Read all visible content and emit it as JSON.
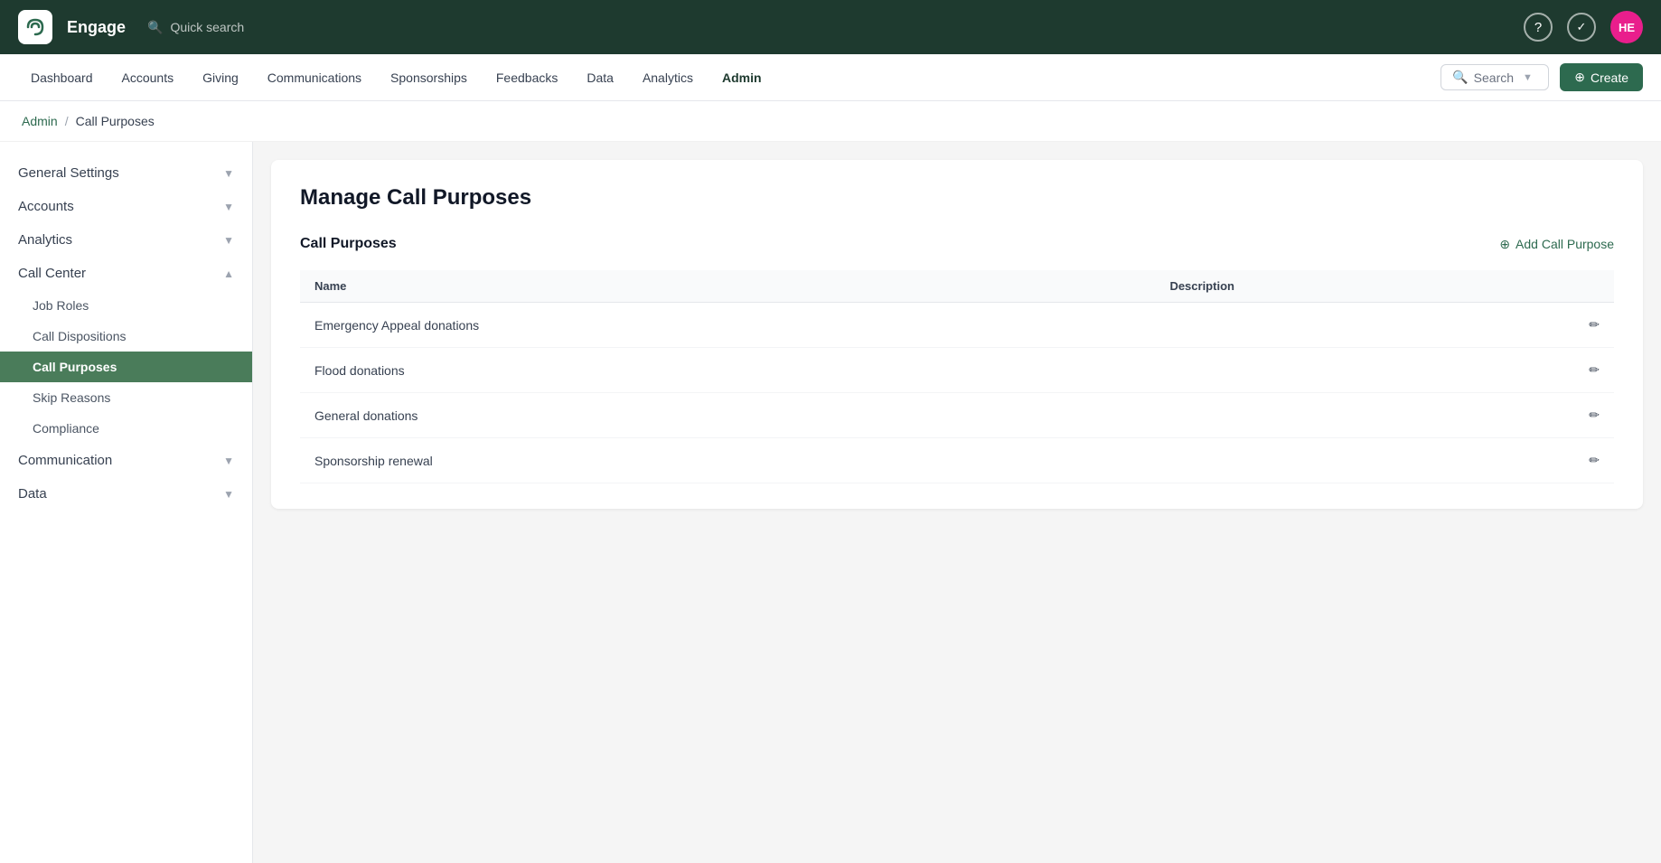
{
  "topbar": {
    "app_name": "Engage",
    "search_placeholder": "Quick search",
    "user_initials": "HE"
  },
  "secondnav": {
    "items": [
      {
        "label": "Dashboard",
        "active": false
      },
      {
        "label": "Accounts",
        "active": false
      },
      {
        "label": "Giving",
        "active": false
      },
      {
        "label": "Communications",
        "active": false
      },
      {
        "label": "Sponsorships",
        "active": false
      },
      {
        "label": "Feedbacks",
        "active": false
      },
      {
        "label": "Data",
        "active": false
      },
      {
        "label": "Analytics",
        "active": false
      },
      {
        "label": "Admin",
        "active": true
      }
    ],
    "search_label": "Search",
    "create_label": "Create"
  },
  "breadcrumb": {
    "parent": "Admin",
    "current": "Call Purposes"
  },
  "sidebar": {
    "sections": [
      {
        "label": "General Settings",
        "expanded": false,
        "items": []
      },
      {
        "label": "Accounts",
        "expanded": false,
        "items": []
      },
      {
        "label": "Analytics",
        "expanded": false,
        "items": []
      },
      {
        "label": "Call Center",
        "expanded": true,
        "items": [
          {
            "label": "Job Roles",
            "active": false
          },
          {
            "label": "Call Dispositions",
            "active": false
          },
          {
            "label": "Call Purposes",
            "active": true
          },
          {
            "label": "Skip Reasons",
            "active": false
          },
          {
            "label": "Compliance",
            "active": false
          }
        ]
      },
      {
        "label": "Communication",
        "expanded": false,
        "items": []
      },
      {
        "label": "Data",
        "expanded": false,
        "items": []
      }
    ]
  },
  "main": {
    "page_title": "Manage Call Purposes",
    "section_label": "Call Purposes",
    "add_button_label": "Add Call Purpose",
    "table_headers": [
      "Name",
      "Description"
    ],
    "rows": [
      {
        "name": "Emergency Appeal donations",
        "description": ""
      },
      {
        "name": "Flood donations",
        "description": ""
      },
      {
        "name": "General donations",
        "description": ""
      },
      {
        "name": "Sponsorship renewal",
        "description": ""
      }
    ]
  },
  "colors": {
    "brand_dark": "#1e3a2f",
    "brand_green": "#2d6a4f",
    "sidebar_active_bg": "#4a7c5a",
    "avatar_pink": "#e91e8c"
  }
}
